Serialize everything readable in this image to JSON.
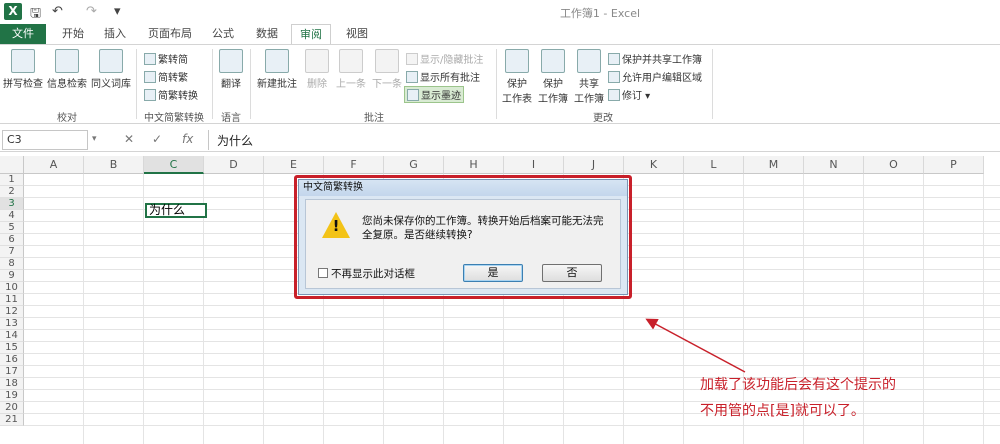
{
  "title_bar": {
    "app_icon": "X",
    "doc_title": "工作簿1 - Excel"
  },
  "tabs": [
    "文件",
    "开始",
    "插入",
    "页面布局",
    "公式",
    "数据",
    "审阅",
    "视图"
  ],
  "ribbon": {
    "proofing": {
      "spell": "拼写检查",
      "research": "信息检索",
      "thesaurus": "同义词库",
      "group": "校对"
    },
    "chinese": {
      "to_trad": "繁转简",
      "to_simp": "简转繁",
      "convert": "简繁转换",
      "group": "中文简繁转换"
    },
    "language": {
      "translate": "翻译",
      "group": "语言"
    },
    "comments": {
      "new": "新建批注",
      "delete": "删除",
      "prev": "上一条",
      "next": "下一条",
      "show_hide": "显示/隐藏批注",
      "show_all": "显示所有批注",
      "show_ink": "显示墨迹",
      "group": "批注"
    },
    "changes": {
      "protect_sheet_1": "保护",
      "protect_sheet_2": "工作表",
      "protect_wb_1": "保护",
      "protect_wb_2": "工作簿",
      "share_1": "共享",
      "share_2": "工作簿",
      "protect_share": "保护并共享工作簿",
      "allow_edit": "允许用户编辑区域",
      "track": "修订 ▾",
      "group": "更改"
    }
  },
  "formula_bar": {
    "name_box": "C3",
    "fx": "fx",
    "cancel": "✕",
    "enter": "✓",
    "formula": "为什么"
  },
  "sheet": {
    "columns": [
      "A",
      "B",
      "C",
      "D",
      "E",
      "F",
      "G",
      "H",
      "I",
      "J",
      "K",
      "L",
      "M",
      "N",
      "O",
      "P"
    ],
    "rows": [
      "1",
      "2",
      "3",
      "4",
      "5",
      "6",
      "7",
      "8",
      "9",
      "10",
      "11",
      "12",
      "13",
      "14",
      "15",
      "16",
      "17",
      "18",
      "19",
      "20",
      "21"
    ],
    "cell_c3": "为什么"
  },
  "dialog": {
    "title": "中文简繁转换",
    "message": "您尚未保存你的工作簿。转换开始后档案可能无法完全复原。是否继续转换?",
    "checkbox": "不再显示此对话框",
    "yes": "是",
    "no": "否"
  },
  "annotation": {
    "line1": "加载了该功能后会有这个提示的",
    "line2": "不用管的点[是]就可以了。",
    "color": "#c8202a"
  }
}
